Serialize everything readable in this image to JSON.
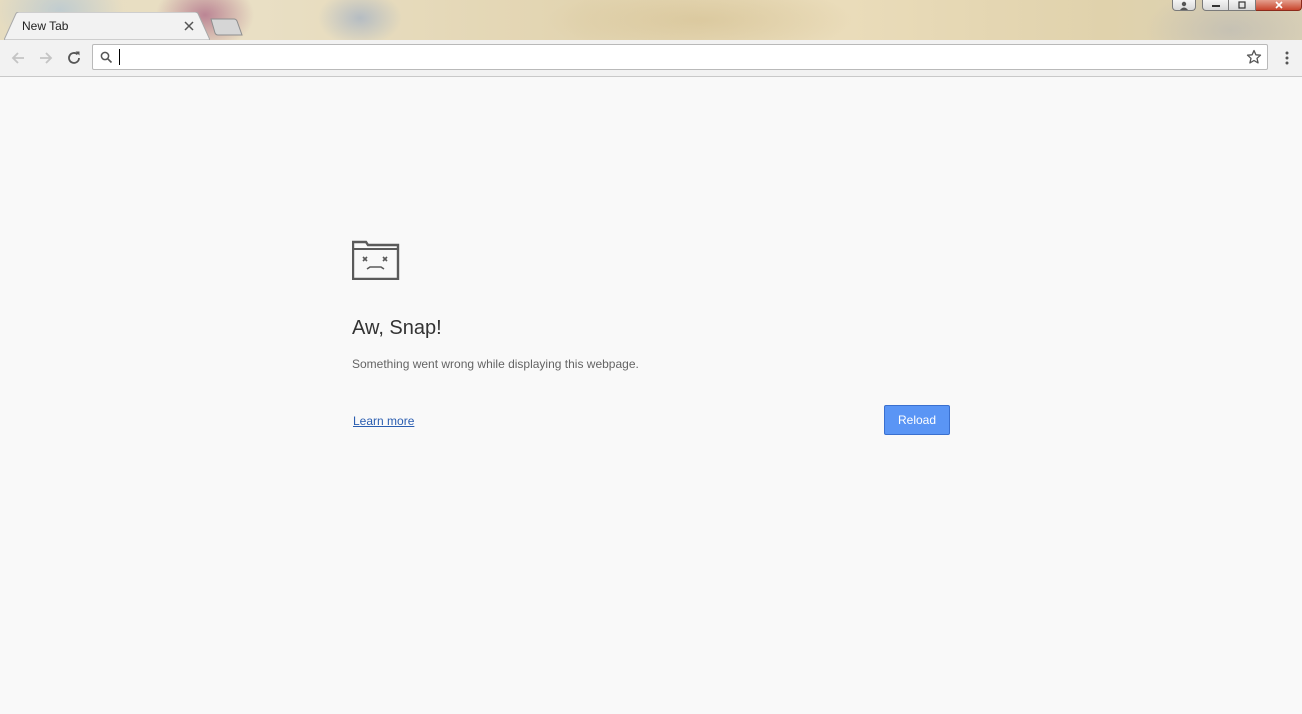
{
  "tab": {
    "title": "New Tab",
    "close_icon": "close-icon"
  },
  "toolbar": {
    "back_icon": "arrow-left-icon",
    "forward_icon": "arrow-right-icon",
    "reload_icon": "reload-icon",
    "omnibox": {
      "value": "",
      "search_icon": "search-icon",
      "bookmark_icon": "star-icon"
    },
    "menu_icon": "vertical-dots-icon"
  },
  "error_page": {
    "icon": "sad-folder-icon",
    "heading": "Aw, Snap!",
    "message": "Something went wrong while displaying this webpage.",
    "learn_more": "Learn more",
    "reload_label": "Reload"
  },
  "colors": {
    "reload_button": "#5a95f5",
    "link": "#2a5db0",
    "page_background": "#f9f9f9"
  }
}
